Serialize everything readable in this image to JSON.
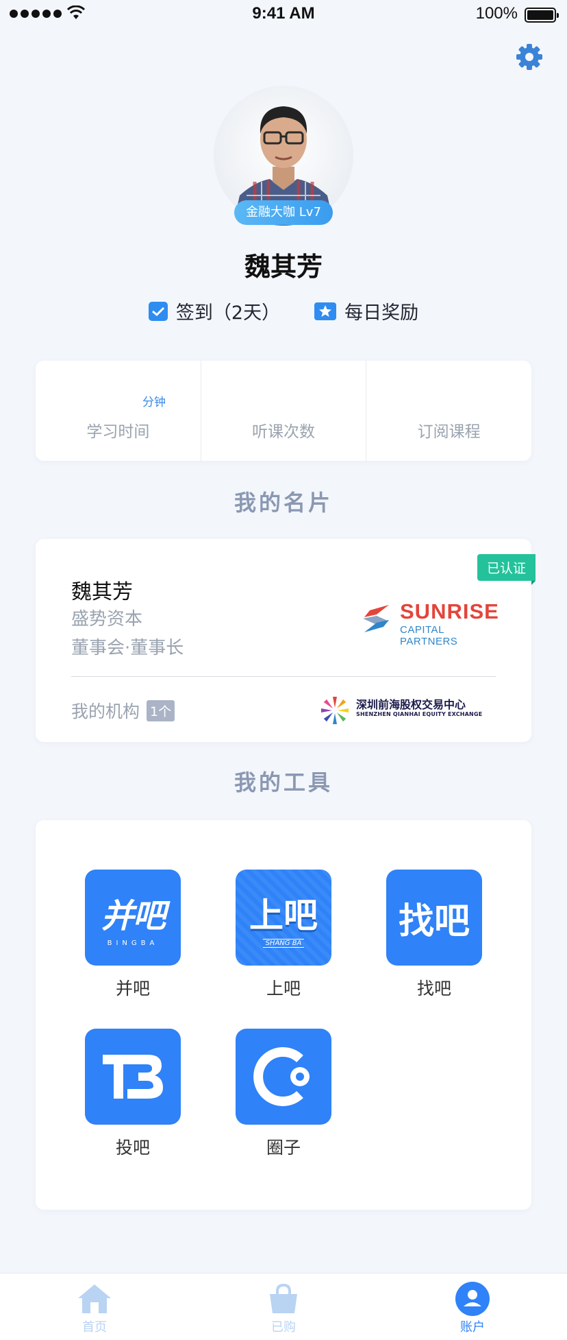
{
  "status_bar": {
    "time": "9:41 AM",
    "battery": "100%"
  },
  "profile": {
    "level_badge": "金融大咖 Lv7",
    "name": "魏其芳",
    "checkin_label": "签到（2天）",
    "daily_reward_label": "每日奖励"
  },
  "stats": [
    {
      "label": "学习时间",
      "unit": "分钟"
    },
    {
      "label": "听课次数"
    },
    {
      "label": "订阅课程"
    }
  ],
  "sections": {
    "card_title": "我的名片",
    "tools_title": "我的工具"
  },
  "business_card": {
    "verified": "已认证",
    "name": "魏其芳",
    "company": "盛势资本",
    "title": "董事会·董事长",
    "logo_main": "SUNRISE",
    "logo_sub": "CAPITAL PARTNERS",
    "org_label": "我的机构",
    "org_count": "1个",
    "org_name": "深圳前海股权交易中心",
    "org_name_en": "SHENZHEN QIANHAI EQUITY EXCHANGE"
  },
  "tools": [
    {
      "label": "并吧",
      "icon_text": "并吧",
      "icon_sub": "BINGBA"
    },
    {
      "label": "上吧",
      "icon_text": "上吧",
      "icon_sub": "SHANG BA"
    },
    {
      "label": "找吧",
      "icon_text": "找吧"
    },
    {
      "label": "投吧",
      "icon_text": "TB"
    },
    {
      "label": "圈子",
      "icon_text": "C"
    }
  ],
  "tabbar": [
    {
      "label": "首页",
      "icon": "home-icon"
    },
    {
      "label": "已购",
      "icon": "bag-icon"
    },
    {
      "label": "账户",
      "icon": "user-icon",
      "active": true
    }
  ],
  "colors": {
    "accent": "#2f82f7",
    "verified": "#23c29a",
    "section_title": "#8a98b2"
  }
}
